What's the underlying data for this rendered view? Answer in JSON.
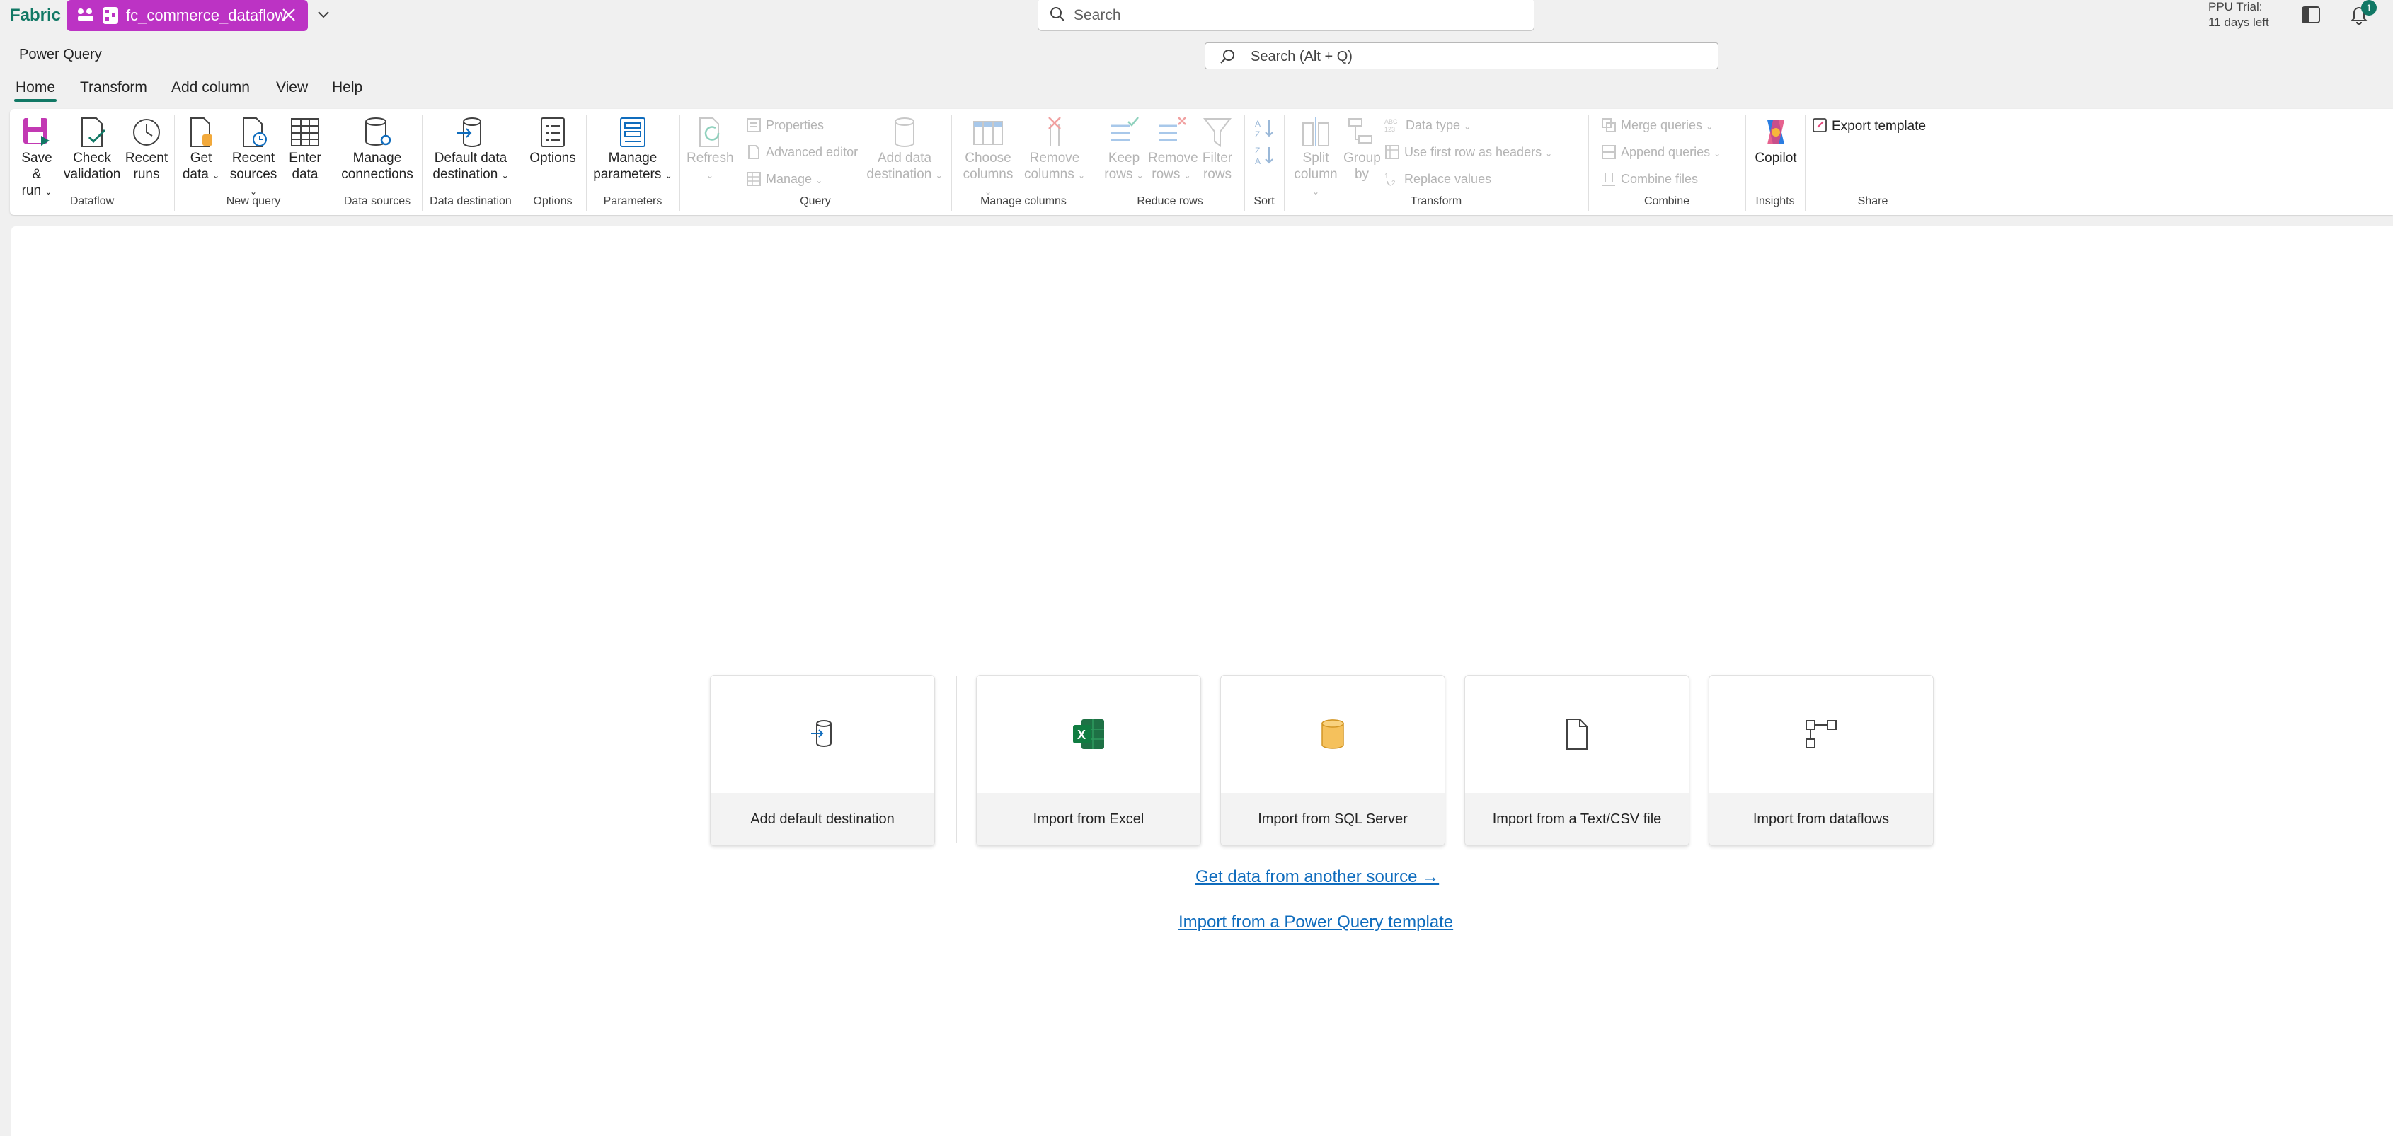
{
  "topbar": {
    "brand": "Fabric",
    "tab_label": "fc_commerce_dataflow",
    "search_placeholder": "Search",
    "trial_line1": "PPU Trial:",
    "trial_line2": "11 days left",
    "notification_count": "1"
  },
  "app": {
    "title": "Power Query",
    "search_placeholder": "Search (Alt + Q)"
  },
  "ribbon_tabs": [
    "Home",
    "Transform",
    "Add column",
    "View",
    "Help"
  ],
  "ribbon": {
    "dataflow": {
      "save_run_1": "Save &",
      "save_run_2": "run",
      "check_1": "Check",
      "check_2": "validation",
      "recent_runs_1": "Recent",
      "recent_runs_2": "runs",
      "group": "Dataflow"
    },
    "new_query": {
      "get_data_1": "Get",
      "get_data_2": "data",
      "recent_sources_1": "Recent",
      "recent_sources_2": "sources",
      "enter_data_1": "Enter",
      "enter_data_2": "data",
      "group": "New query"
    },
    "data_sources": {
      "manage_1": "Manage",
      "manage_2": "connections",
      "group": "Data sources"
    },
    "data_destination": {
      "default_1": "Default data",
      "default_2": "destination",
      "group": "Data destination"
    },
    "options": {
      "options": "Options",
      "group": "Options"
    },
    "parameters": {
      "manage_1": "Manage",
      "manage_2": "parameters",
      "group": "Parameters"
    },
    "query": {
      "refresh": "Refresh",
      "properties": "Properties",
      "advanced_editor": "Advanced editor",
      "manage": "Manage",
      "add_dest_1": "Add data",
      "add_dest_2": "destination",
      "group": "Query"
    },
    "manage_columns": {
      "choose_1": "Choose",
      "choose_2": "columns",
      "remove_1": "Remove",
      "remove_2": "columns",
      "group": "Manage columns"
    },
    "reduce_rows": {
      "keep_1": "Keep",
      "keep_2": "rows",
      "remove_1": "Remove",
      "remove_2": "rows",
      "filter_1": "Filter",
      "filter_2": "rows",
      "group": "Reduce rows"
    },
    "sort": {
      "group": "Sort"
    },
    "transform": {
      "split_1": "Split",
      "split_2": "column",
      "group_by_1": "Group",
      "group_by_2": "by",
      "data_type": "Data type",
      "first_row": "Use first row as headers",
      "replace": "Replace values",
      "group": "Transform"
    },
    "combine": {
      "merge": "Merge queries",
      "append": "Append queries",
      "combine_files": "Combine files",
      "group": "Combine"
    },
    "insights": {
      "copilot": "Copilot",
      "group": "Insights"
    },
    "share": {
      "export": "Export template",
      "group": "Share"
    }
  },
  "cards": [
    {
      "label": "Add default destination",
      "icon": "destination-icon"
    },
    {
      "label": "Import from Excel",
      "icon": "excel-icon"
    },
    {
      "label": "Import from SQL Server",
      "icon": "sql-server-icon"
    },
    {
      "label": "Import from a Text/CSV file",
      "icon": "text-file-icon"
    },
    {
      "label": "Import from dataflows",
      "icon": "dataflows-icon"
    }
  ],
  "links": {
    "another_source": "Get data from another source →",
    "template": "Import from a Power Query template"
  },
  "colors": {
    "accent": "#117865",
    "tab_pill": "#bc33c4",
    "link": "#0f6cbd"
  }
}
